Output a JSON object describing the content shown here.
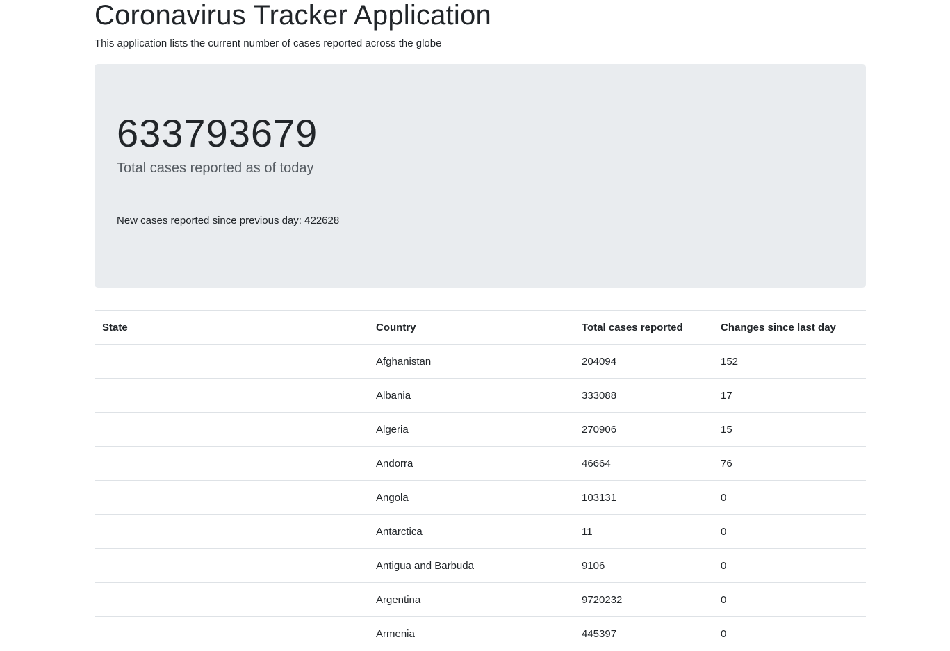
{
  "header": {
    "title": "Coronavirus Tracker Application",
    "subtitle": "This application lists the current number of cases reported across the globe"
  },
  "summary": {
    "total_cases": "633793679",
    "total_label": "Total cases reported as of today",
    "new_cases_text": "New cases reported since previous day: 422628"
  },
  "table": {
    "headers": [
      "State",
      "Country",
      "Total cases reported",
      "Changes since last day"
    ],
    "rows": [
      {
        "state": "",
        "country": "Afghanistan",
        "total": "204094",
        "change": "152"
      },
      {
        "state": "",
        "country": "Albania",
        "total": "333088",
        "change": "17"
      },
      {
        "state": "",
        "country": "Algeria",
        "total": "270906",
        "change": "15"
      },
      {
        "state": "",
        "country": "Andorra",
        "total": "46664",
        "change": "76"
      },
      {
        "state": "",
        "country": "Angola",
        "total": "103131",
        "change": "0"
      },
      {
        "state": "",
        "country": "Antarctica",
        "total": "11",
        "change": "0"
      },
      {
        "state": "",
        "country": "Antigua and Barbuda",
        "total": "9106",
        "change": "0"
      },
      {
        "state": "",
        "country": "Argentina",
        "total": "9720232",
        "change": "0"
      },
      {
        "state": "",
        "country": "Armenia",
        "total": "445397",
        "change": "0"
      }
    ]
  },
  "colors": {
    "jumbotron_bg": "#e9ecef",
    "text": "#212529",
    "border": "#dee2e6"
  }
}
